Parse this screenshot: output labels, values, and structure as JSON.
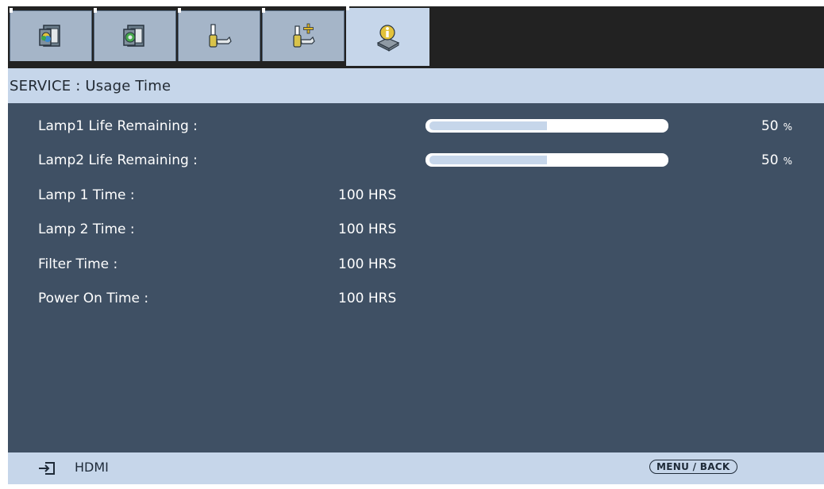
{
  "tabs": [
    {
      "icon": "display-picture-icon",
      "active": false
    },
    {
      "icon": "display-settings-icon",
      "active": false
    },
    {
      "icon": "setup-tools-icon",
      "active": false
    },
    {
      "icon": "advanced-tools-icon",
      "active": false
    },
    {
      "icon": "service-info-icon",
      "active": true
    }
  ],
  "header": {
    "title": "SERVICE : Usage Time"
  },
  "rows": {
    "lamp1_life": {
      "label": "Lamp1 Life Remaining :",
      "percent": "50",
      "unit": "%",
      "level": 0.5
    },
    "lamp2_life": {
      "label": "Lamp2 Life Remaining :",
      "percent": "50",
      "unit": "%",
      "level": 0.5
    },
    "lamp1_time": {
      "label": "Lamp 1 Time :",
      "value": "100 HRS"
    },
    "lamp2_time": {
      "label": "Lamp 2 Time :",
      "value": "100 HRS"
    },
    "filter_time": {
      "label": "Filter Time :",
      "value": "100 HRS"
    },
    "power_on_time": {
      "label": "Power On Time :",
      "value": "100 HRS"
    }
  },
  "footer": {
    "source_icon": "input-source-icon",
    "source": "HDMI",
    "menu_back": "MENU / BACK"
  },
  "colors": {
    "panel": "#3f5064",
    "header": "#c6d6ea",
    "tab": "#a5b5c8",
    "bar_fill": "#c6d6ea"
  }
}
